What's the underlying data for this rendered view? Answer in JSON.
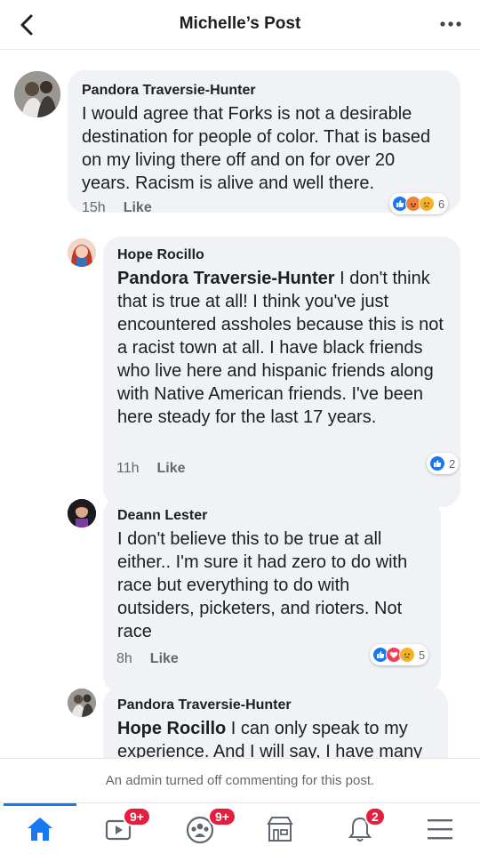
{
  "header": {
    "title": "Michelle’s Post",
    "back_icon": "chevron-left-icon",
    "more_icon": "more-horizontal-icon"
  },
  "comments": [
    {
      "author": "Pandora Traversie-Hunter",
      "mention": "",
      "text": "I would agree that Forks is not a desirable destination for people of color. That is based on my living there off and on for over 20 years. Racism is alive and well there.",
      "time": "15h",
      "like_label": "Like",
      "reaction_icons": [
        "like-reaction-icon",
        "angry-reaction-icon",
        "sad-reaction-icon"
      ],
      "reaction_count": "6"
    },
    {
      "author": "Hope Rocillo",
      "mention": "Pandora Traversie-Hunter",
      "text": " I don't think that is true at all! I think you've just encountered assholes because this is not a racist town at all. I have black friends who live here and hispanic friends along with Native American friends. I've been here steady for the last 17 years.",
      "time": "11h",
      "like_label": "Like",
      "reaction_icons": [
        "like-reaction-icon"
      ],
      "reaction_count": "2"
    },
    {
      "author": "Deann Lester",
      "mention": "",
      "text": "I don't believe this to be true at all either.. I'm sure it had zero to do with race but everything to do with outsiders, picketers, and rioters. Not race",
      "time": "8h",
      "like_label": "Like",
      "reaction_icons": [
        "like-reaction-icon",
        "love-reaction-icon",
        "sad-reaction-icon"
      ],
      "reaction_count": "5"
    },
    {
      "author": "Pandora Traversie-Hunter",
      "mention": "Hope Rocillo",
      "text": " I can only speak to my experience. And I will say, I have many"
    }
  ],
  "notice": "An admin turned off commenting for this post.",
  "bottom_nav": {
    "items": [
      {
        "icon": "home-icon",
        "badge": ""
      },
      {
        "icon": "video-icon",
        "badge": "9+"
      },
      {
        "icon": "groups-icon",
        "badge": "9+"
      },
      {
        "icon": "marketplace-icon",
        "badge": ""
      },
      {
        "icon": "notifications-bell-icon",
        "badge": "2"
      },
      {
        "icon": "menu-icon",
        "badge": ""
      }
    ]
  },
  "colors": {
    "accent": "#1877f2",
    "bubble": "#f0f2f5",
    "badge": "#e41e3f",
    "meta_text": "#65676b"
  }
}
